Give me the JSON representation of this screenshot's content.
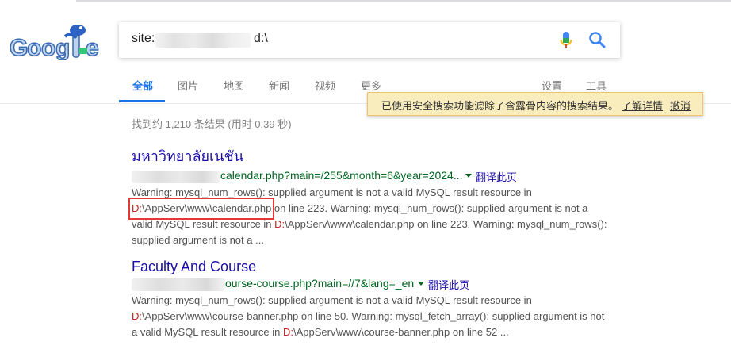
{
  "search": {
    "query_prefix": "site:",
    "query_suffix": "d:\\"
  },
  "tabs": [
    {
      "label": "全部"
    },
    {
      "label": "图片"
    },
    {
      "label": "地图"
    },
    {
      "label": "新闻"
    },
    {
      "label": "视频"
    },
    {
      "label": "更多"
    },
    {
      "label": "设置"
    },
    {
      "label": "工具"
    }
  ],
  "notice": {
    "text": "已使用安全搜索功能滤除了含露骨内容的搜索结果。",
    "learn_more": "了解详情",
    "dismiss": "撤消"
  },
  "stats": "找到约 1,210 条结果  (用时 0.39 秒)",
  "results": [
    {
      "title": "มหาวิทยาลัยเนชั่น",
      "url_text": "calendar.php?main=/255&month=6&year=2024...",
      "translate": "翻译此页",
      "snippet": {
        "line1": "Warning: mysql_num_rows(): supplied argument is not a valid MySQL result resource in",
        "path_drive": "D:",
        "path_rest": "\\AppServ\\www\\calendar.php",
        "line2_tail": " on line 223. Warning: mysql_num_rows(): supplied argument is not a",
        "line3_head": "valid MySQL result resource in ",
        "path2_drive": "D:",
        "line3_tail": "\\AppServ\\www\\calendar.php on line 223. Warning: mysql_num_rows():",
        "line4": "supplied argument is not a ..."
      }
    },
    {
      "title": "Faculty And Course",
      "url_text": "ourse-course.php?main=//7&lang=_en",
      "translate": "翻译此页",
      "snippet": {
        "line1": "Warning: mysql_num_rows(): supplied argument is not a valid MySQL result resource in",
        "path_drive": "D:",
        "line2_tail": "\\AppServ\\www\\course-banner.php on line 50. Warning: mysql_fetch_array(): supplied argument is not",
        "line3_head": "a valid MySQL result resource in ",
        "path2_drive": "D:",
        "line3_tail": "\\AppServ\\www\\course-banner.php on line 52 ..."
      }
    }
  ],
  "colors": {
    "link": "#1a0dab",
    "url": "#006621",
    "accent": "#1a73e8",
    "highlight_red": "#c5221f",
    "notice_bg": "#f9edbe"
  }
}
